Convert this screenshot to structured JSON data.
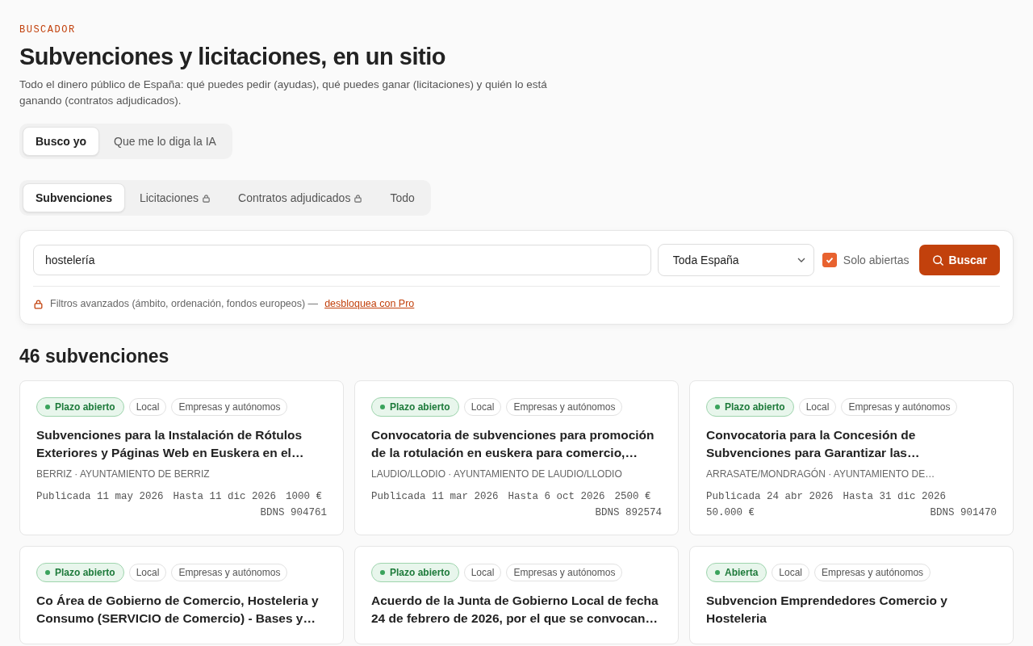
{
  "eyebrow": "BUSCADOR",
  "title": "Subvenciones y licitaciones, en un sitio",
  "intro": "Todo el dinero público de España: qué puedes pedir (ayudas), qué puedes ganar (licitaciones) y quién lo está ganando (contratos adjudicados).",
  "modes": [
    {
      "label": "Busco yo",
      "selected": true
    },
    {
      "label": "Que me lo diga la IA",
      "selected": false
    }
  ],
  "tabs": [
    {
      "label": "Subvenciones",
      "selected": true,
      "locked": false
    },
    {
      "label": "Licitaciones",
      "selected": false,
      "locked": true
    },
    {
      "label": "Contratos adjudicados",
      "selected": false,
      "locked": true
    },
    {
      "label": "Todo",
      "selected": false,
      "locked": false
    }
  ],
  "search": {
    "value": "hostelería",
    "region": "Toda España",
    "only_open": {
      "label": "Solo abiertas",
      "checked": true
    },
    "button": "Buscar",
    "notice": "Filtros avanzados (ámbito, ordenación, fondos europeos) —",
    "notice_link": "desbloquea con Pro"
  },
  "results_title": "46 subvenciones",
  "results": [
    {
      "status": "Plazo abierto",
      "tags": [
        "Local",
        "Empresas y autónomos"
      ],
      "title": "Subvenciones para la Instalación de Rótulos Exteriores y Páginas Web en Euskera en el…",
      "org": "BERRIZ · AYUNTAMIENTO DE BERRIZ",
      "published": "Publicada 11 may 2026",
      "until": "Hasta 11 dic 2026",
      "amount": "1000 €",
      "bdns": "BDNS 904761"
    },
    {
      "status": "Plazo abierto",
      "tags": [
        "Local",
        "Empresas y autónomos"
      ],
      "title": "Convocatoria de subvenciones para promoción de la rotulación en euskera para comercio,…",
      "org": "LAUDIO/LLODIO · AYUNTAMIENTO DE LAUDIO/LLODIO",
      "published": "Publicada 11 mar 2026",
      "until": "Hasta 6 oct 2026",
      "amount": "2500 €",
      "bdns": "BDNS 892574"
    },
    {
      "status": "Plazo abierto",
      "tags": [
        "Local",
        "Empresas y autónomos"
      ],
      "title": "Convocatoria para la Concesión de Subvenciones para Garantizar las…",
      "org": "ARRASATE/MONDRAGÓN · AYUNTAMIENTO DE…",
      "published": "Publicada 24 abr 2026",
      "until": "Hasta 31 dic 2026",
      "amount": "50.000 €",
      "bdns": "BDNS 901470"
    },
    {
      "status": "Plazo abierto",
      "tags": [
        "Local",
        "Empresas y autónomos"
      ],
      "title": "Co Área de Gobierno de Comercio, Hosteleria y Consumo (SERVICIO de Comercio) - Bases y…"
    },
    {
      "status": "Plazo abierto",
      "tags": [
        "Local",
        "Empresas y autónomos"
      ],
      "title": "Acuerdo de la Junta de Gobierno Local de fecha 24 de febrero de 2026, por el que se convocan…"
    },
    {
      "status": "Abierta",
      "tags": [
        "Local",
        "Empresas y autónomos"
      ],
      "title": "Subvencion Emprendedores Comercio y Hosteleria"
    }
  ]
}
